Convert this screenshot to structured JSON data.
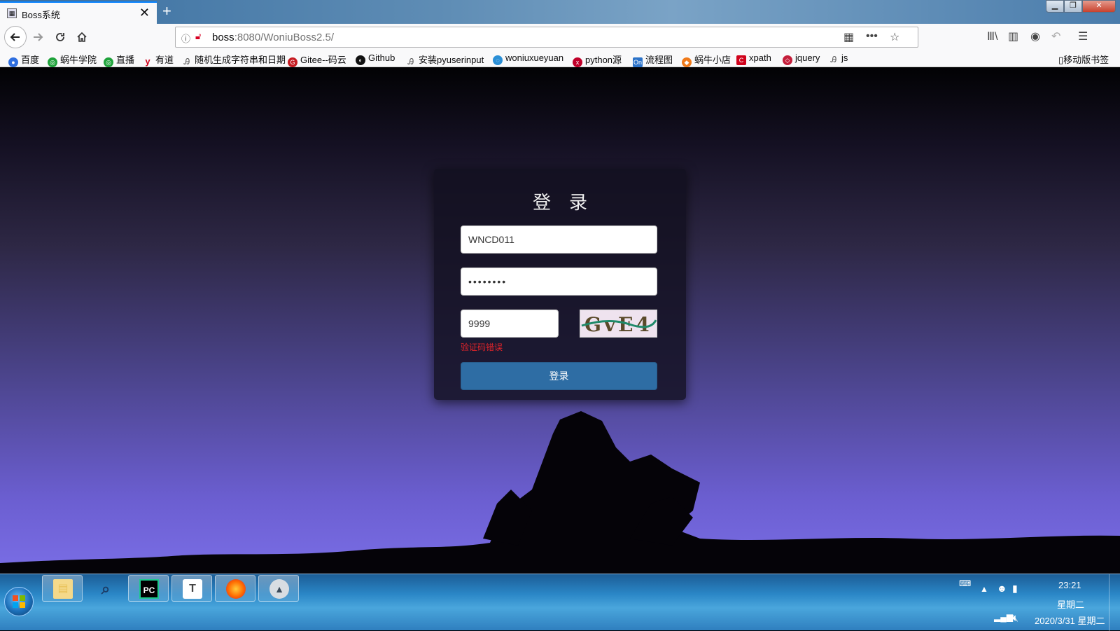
{
  "browser": {
    "tab_title": "Boss系统",
    "tab_close": "✕",
    "new_tab": "+",
    "url_host": "boss",
    "url_rest": ":8080/WoniuBoss2.5/",
    "window_controls": {
      "minimize": "▁",
      "maximize": "❐",
      "close": "✕"
    },
    "bookmarks": [
      {
        "label": "百度",
        "icon": "baidu-icon",
        "color": "#2f6fe0"
      },
      {
        "label": "蜗牛学院",
        "icon": "woniu-icon",
        "color": "#1fa33b"
      },
      {
        "label": "直播",
        "icon": "woniu-icon",
        "color": "#1fa33b"
      },
      {
        "label": "有道",
        "icon": "youdao-icon",
        "color": "#d0021b"
      },
      {
        "label": "随机生成字符串和日期",
        "icon": "bookmark-icon",
        "color": "#555555"
      },
      {
        "label": "Gitee--码云",
        "icon": "gitee-icon",
        "color": "#c71d23"
      },
      {
        "label": "Github",
        "icon": "github-icon",
        "color": "#111111"
      },
      {
        "label": "安装pyuserinput",
        "icon": "bookmark-icon",
        "color": "#555555"
      },
      {
        "label": "woniuxueyuan",
        "icon": "woniuxueyuan-icon",
        "color": "#2b8fd6"
      },
      {
        "label": "python源",
        "icon": "python-icon",
        "color": "#c0002a"
      },
      {
        "label": "流程图",
        "icon": "on-icon",
        "color": "#2c73c9"
      },
      {
        "label": "蜗牛小店",
        "icon": "shop-icon",
        "color": "#f07a1a"
      },
      {
        "label": "xpath",
        "icon": "xpath-icon",
        "color": "#d0021b"
      },
      {
        "label": "jquery",
        "icon": "jquery-icon",
        "color": "#c41e3a"
      },
      {
        "label": "js",
        "icon": "bookmark-icon",
        "color": "#555555"
      }
    ],
    "mobile_bookmarks": "移动版书签"
  },
  "login": {
    "title": "登录",
    "username": "WNCD011",
    "password": "••••••••",
    "vcode": "9999",
    "vcode_error": "验证码错误",
    "submit_label": "登录",
    "captcha_text": "GvE4"
  },
  "taskbar": {
    "apps": [
      {
        "name": "file-explorer-icon",
        "glyph": "▤",
        "color": "#e9c25a"
      },
      {
        "name": "search-tool-icon",
        "glyph": "⌕",
        "color": "#1c3c66"
      },
      {
        "name": "pycharm-icon",
        "glyph": "PC",
        "color": "#1ec98e"
      },
      {
        "name": "typora-icon",
        "glyph": "T",
        "color": "#444444"
      },
      {
        "name": "firefox-icon",
        "glyph": "●",
        "color": "#ff6a00"
      },
      {
        "name": "graduation-app-icon",
        "glyph": "▲",
        "color": "#3a4a5a"
      }
    ],
    "time": "23:21",
    "weekday": "星期二",
    "date": "2020/3/31 星期二"
  }
}
